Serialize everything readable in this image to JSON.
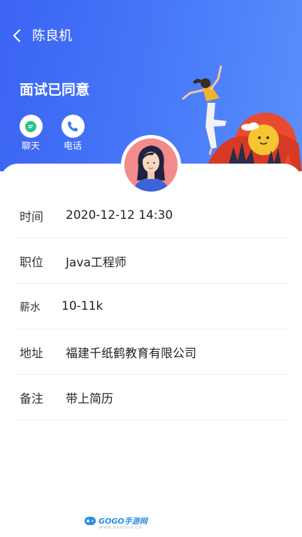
{
  "nav": {
    "title": "陈良机"
  },
  "status": {
    "title": "面试已同意"
  },
  "actions": [
    {
      "label": "聊天",
      "icon": "chat-bubble-icon"
    },
    {
      "label": "电话",
      "icon": "phone-icon"
    }
  ],
  "details": {
    "time": {
      "label": "时间",
      "value": "2020-12-12 14:30"
    },
    "position": {
      "label": "职位",
      "value": "Java工程师"
    },
    "salary": {
      "label": "薪水",
      "value": "10-11k"
    },
    "address": {
      "label": "地址",
      "value": "福建千纸鹤教育有限公司"
    },
    "note": {
      "label": "备注",
      "value": "带上简历"
    }
  },
  "watermark": {
    "text": "GOGO手游网",
    "sub": "WWW.GOGOGO.CN"
  },
  "colors": {
    "header": "#4a7cfa",
    "accent_green": "#2fc08a",
    "accent_blue": "#3a7cf0",
    "avatar_bg": "#f28b8b"
  }
}
